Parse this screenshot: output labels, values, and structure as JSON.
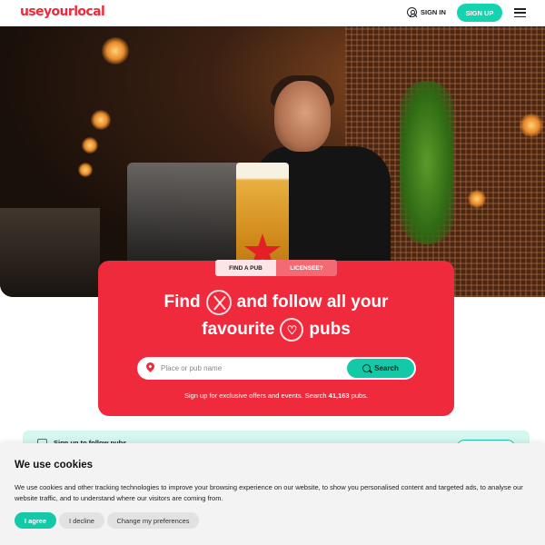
{
  "header": {
    "logo": "useyourlocal",
    "sign_in": "SIGN IN",
    "sign_up": "SIGN UP"
  },
  "search_card": {
    "tabs": [
      "FIND A PUB",
      "LICENSEE?"
    ],
    "headline_line1_a": "Find",
    "headline_line1_b": "and follow all your",
    "headline_line2_a": "favourite",
    "headline_line2_b": "pubs",
    "heart_glyph": "♡",
    "search_placeholder": "Place or pub name",
    "search_button": "Search",
    "note_prefix": "Sign up for exclusive offers and events. Search",
    "note_count": "41,163",
    "note_suffix": "pubs."
  },
  "follow_banner": {
    "text": "Sign up to follow pubs"
  },
  "cookie_banner": {
    "title": "We use cookies",
    "text": "We use cookies and other tracking technologies to improve your browsing experience on our website, to show you personalised content and targeted ads, to analyse our website traffic, and to understand where our visitors are coming from.",
    "agree": "I agree",
    "decline": "I decline",
    "preferences": "Change my preferences"
  },
  "colors": {
    "brand_red": "#ef2a3c",
    "accent_teal": "#14c9a7",
    "banner_mint": "#d4f7ef"
  }
}
